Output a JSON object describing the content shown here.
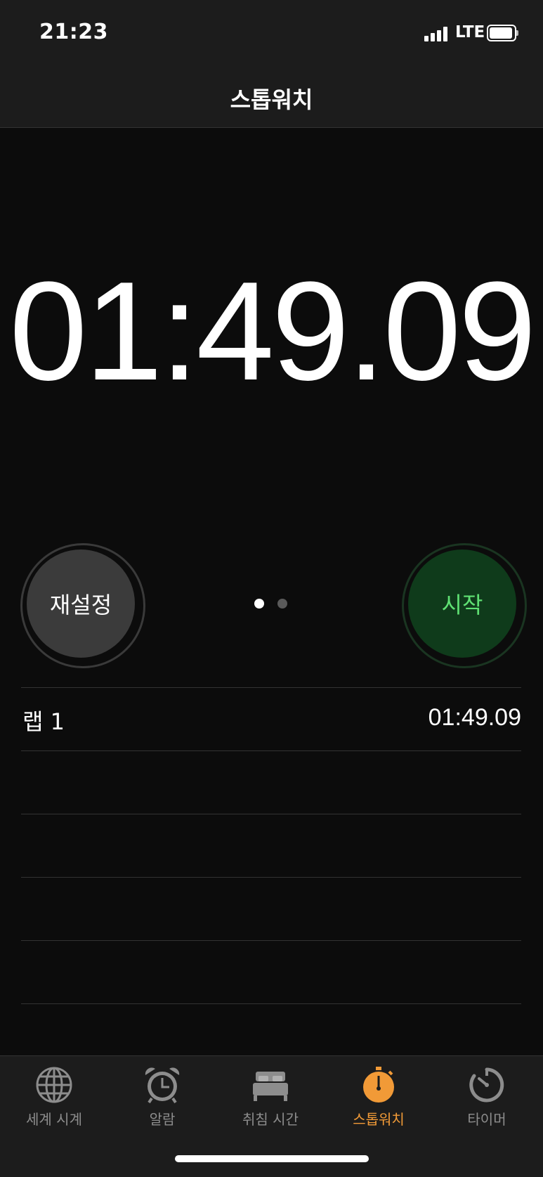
{
  "status": {
    "time": "21:23",
    "network": "LTE"
  },
  "nav": {
    "title": "스톱워치"
  },
  "stopwatch": {
    "display": "01:49.09"
  },
  "controls": {
    "reset_label": "재설정",
    "start_label": "시작",
    "page_count": 2,
    "current_page": 1
  },
  "laps": [
    {
      "label": "랩 1",
      "time": "01:49.09"
    }
  ],
  "tabs": [
    {
      "label": "세계 시계",
      "icon": "globe-icon",
      "active": false
    },
    {
      "label": "알람",
      "icon": "alarm-clock-icon",
      "active": false
    },
    {
      "label": "취침 시간",
      "icon": "bed-icon",
      "active": false
    },
    {
      "label": "스톱워치",
      "icon": "stopwatch-icon",
      "active": true
    },
    {
      "label": "타이머",
      "icon": "timer-icon",
      "active": false
    }
  ],
  "colors": {
    "accent": "#f19a37",
    "start_text": "#5fe173",
    "start_bg": "#0f3b1b",
    "reset_bg": "#3b3b3b",
    "background": "#0c0c0c",
    "bar": "#1c1c1c"
  }
}
